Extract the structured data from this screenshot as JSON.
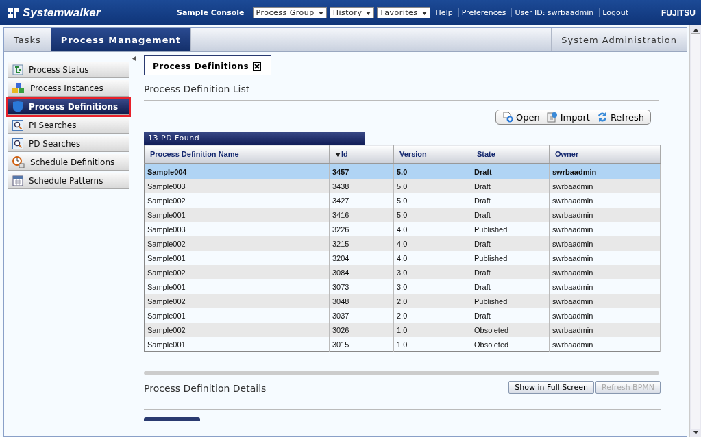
{
  "header": {
    "logo": "Systemwalker",
    "console": "Sample Console",
    "menus": [
      {
        "label": "Process Group"
      },
      {
        "label": "History"
      },
      {
        "label": "Favorites"
      }
    ],
    "links": [
      {
        "kind": "link",
        "label": "Help"
      },
      {
        "kind": "link",
        "label": "Preferences"
      },
      {
        "kind": "text",
        "label": "User ID: swrbaadmin"
      },
      {
        "kind": "link",
        "label": "Logout"
      }
    ],
    "brand": "FUJITSU"
  },
  "tabs": [
    {
      "label": "Tasks",
      "selected": false
    },
    {
      "label": "Process Management",
      "selected": true
    }
  ],
  "right_tab": {
    "label": "System Administration",
    "selected": false
  },
  "sidebar": {
    "items": [
      {
        "label": "Process Status",
        "kind": "status",
        "selected": false
      },
      {
        "label": "Process Instances",
        "kind": "instances",
        "selected": false
      },
      {
        "label": "Process Definitions",
        "kind": "definitions",
        "selected": true
      },
      {
        "label": "PI Searches",
        "kind": "search",
        "selected": false
      },
      {
        "label": "PD Searches",
        "kind": "search",
        "selected": false
      },
      {
        "label": "Schedule Definitions",
        "kind": "clock",
        "selected": false
      },
      {
        "label": "Schedule Patterns",
        "kind": "calendar",
        "selected": false
      }
    ]
  },
  "content_tab": {
    "label": "Process Definitions"
  },
  "list": {
    "title": "Process Definition List",
    "toolbar": [
      {
        "label": "Open",
        "kind": "open"
      },
      {
        "label": "Import",
        "kind": "import"
      },
      {
        "label": "Refresh",
        "kind": "refresh"
      }
    ],
    "found": "13 PD Found",
    "columns": [
      {
        "label": "Process Definition Name",
        "sorted": false
      },
      {
        "label": "Id",
        "sorted": true
      },
      {
        "label": "Version",
        "sorted": false
      },
      {
        "label": "State",
        "sorted": false
      },
      {
        "label": "Owner",
        "sorted": false
      }
    ],
    "rows": [
      {
        "cells": [
          "Sample004",
          "3457",
          "5.0",
          "Draft",
          "swrbaadmin"
        ],
        "selected": true
      },
      {
        "cells": [
          "Sample003",
          "3438",
          "5.0",
          "Draft",
          "swrbaadmin"
        ],
        "selected": false
      },
      {
        "cells": [
          "Sample002",
          "3427",
          "5.0",
          "Draft",
          "swrbaadmin"
        ],
        "selected": false
      },
      {
        "cells": [
          "Sample001",
          "3416",
          "5.0",
          "Draft",
          "swrbaadmin"
        ],
        "selected": false
      },
      {
        "cells": [
          "Sample003",
          "3226",
          "4.0",
          "Published",
          "swrbaadmin"
        ],
        "selected": false
      },
      {
        "cells": [
          "Sample002",
          "3215",
          "4.0",
          "Draft",
          "swrbaadmin"
        ],
        "selected": false
      },
      {
        "cells": [
          "Sample001",
          "3204",
          "4.0",
          "Published",
          "swrbaadmin"
        ],
        "selected": false
      },
      {
        "cells": [
          "Sample002",
          "3084",
          "3.0",
          "Draft",
          "swrbaadmin"
        ],
        "selected": false
      },
      {
        "cells": [
          "Sample001",
          "3073",
          "3.0",
          "Draft",
          "swrbaadmin"
        ],
        "selected": false
      },
      {
        "cells": [
          "Sample002",
          "3048",
          "2.0",
          "Published",
          "swrbaadmin"
        ],
        "selected": false
      },
      {
        "cells": [
          "Sample001",
          "3037",
          "2.0",
          "Draft",
          "swrbaadmin"
        ],
        "selected": false
      },
      {
        "cells": [
          "Sample002",
          "3026",
          "1.0",
          "Obsoleted",
          "swrbaadmin"
        ],
        "selected": false
      },
      {
        "cells": [
          "Sample001",
          "3015",
          "1.0",
          "Obsoleted",
          "swrbaadmin"
        ],
        "selected": false
      }
    ]
  },
  "details": {
    "title": "Process Definition Details",
    "buttons": [
      {
        "label": "Show in Full Screen",
        "disabled": false
      },
      {
        "label": "Refresh BPMN",
        "disabled": true
      }
    ]
  }
}
